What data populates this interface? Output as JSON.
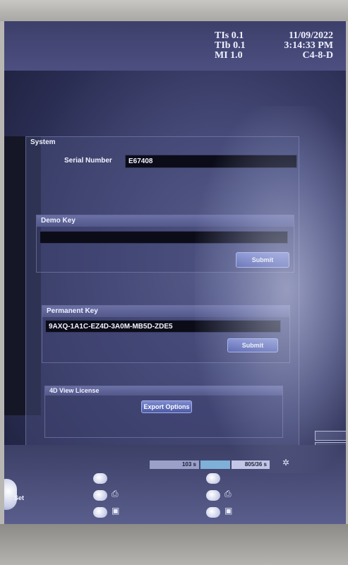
{
  "hud": {
    "tis": "TIs  0.1",
    "tib": "TIb  0.1",
    "mi": "MI  1.0",
    "date": "11/09/2022",
    "time": "3:14:33 PM",
    "probe": "C4-8-D"
  },
  "system": {
    "title": "System",
    "serial_label": "Serial Number",
    "serial_value": "E67408"
  },
  "demo_key": {
    "title": "Demo Key",
    "value": "",
    "submit_label": "Submit"
  },
  "permanent_key": {
    "title": "Permanent Key",
    "value": "9AXQ-1A1C-EZ4D-3A0M-MB5D-ZDE5",
    "submit_label": "Submit"
  },
  "view4d": {
    "title": "4D View License",
    "export_label": "Export Options"
  },
  "status": {
    "left_value": "103 s",
    "right_value": "805/36 s"
  },
  "controls": {
    "set_label": "Set"
  },
  "colors": {
    "panel": "#464a78",
    "group_title": "#5f6498",
    "button": "#6471bd",
    "field": "#0b0c18"
  },
  "icons": [
    "gear-icon",
    "printer-icon",
    "save-icon"
  ]
}
